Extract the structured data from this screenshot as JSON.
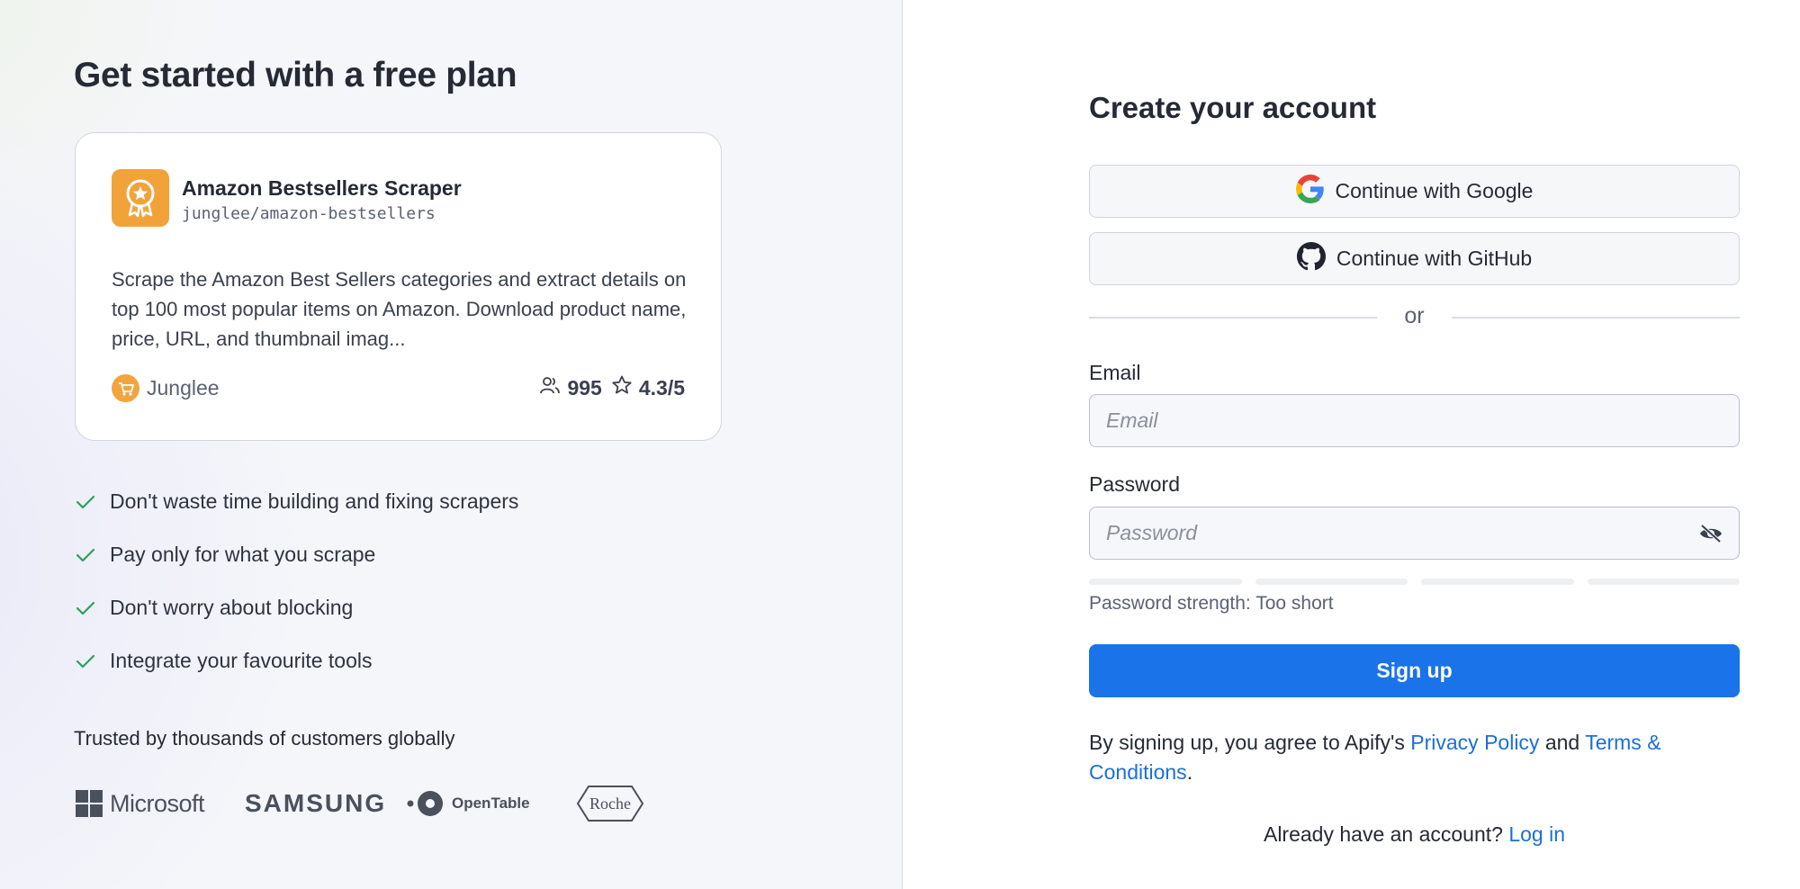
{
  "hero": {
    "title": "Get started with a free plan"
  },
  "actor_card": {
    "name": "Amazon Bestsellers Scraper",
    "slug": "junglee/amazon-bestsellers",
    "description": "Scrape the Amazon Best Sellers categories and extract details on top 100 most popular items on Amazon. Download product name, price, URL, and thumbnail imag...",
    "author": "Junglee",
    "users": "995",
    "rating": "4.3/5",
    "logo_icon": "award-badge-icon",
    "colors": {
      "logo_bg": "#f1a33a",
      "author_avatar_bg": "#f2a43f"
    }
  },
  "benefits": [
    "Don't waste time building and fixing scrapers",
    "Pay only for what you scrape",
    "Don't worry about blocking",
    "Integrate your favourite tools"
  ],
  "trusted": {
    "text": "Trusted by thousands of customers globally",
    "logos": [
      "Microsoft",
      "SAMSUNG",
      "OpenTable",
      "Roche"
    ]
  },
  "form": {
    "title": "Create your account",
    "google_label": "Continue with Google",
    "github_label": "Continue with GitHub",
    "divider_text": "or",
    "email_label": "Email",
    "email_placeholder": "Email",
    "email_value": "",
    "password_label": "Password",
    "password_placeholder": "Password",
    "password_value": "",
    "strength_text": "Password strength: Too short",
    "signup_label": "Sign up",
    "legal_prefix": "By signing up, you agree to Apify's ",
    "privacy_link": "Privacy Policy",
    "legal_and": " and ",
    "terms_link": "Terms & Conditions",
    "legal_suffix": ".",
    "login_prompt": "Already have an account? ",
    "login_link": "Log in"
  },
  "colors": {
    "primary": "#1a73e8",
    "link": "#1a6fd9",
    "check": "#2f9e5a"
  }
}
